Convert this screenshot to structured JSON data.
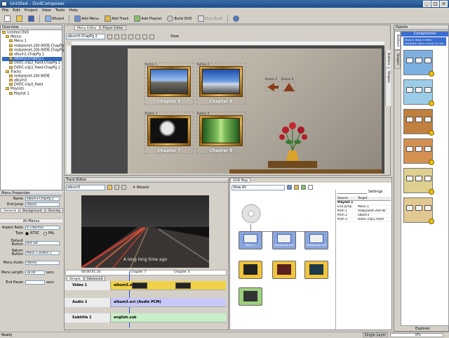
{
  "window": {
    "title": "Untitled - DvdComposer"
  },
  "menubar": [
    "File",
    "Edit",
    "Project",
    "View",
    "Tools",
    "Help"
  ],
  "toolbar": {
    "wizard": "Wizard",
    "add_menu": "Add Menu",
    "add_track": "Add Track",
    "add_playlist": "Add Playlist",
    "build_dvd": "Build DVD",
    "stop_build": "Stop Build"
  },
  "overview": {
    "title": "Overview",
    "tree": [
      {
        "label": "Untitled DVD",
        "indent": 0
      },
      {
        "label": "Menus",
        "indent": 1
      },
      {
        "label": "Menu 1",
        "indent": 2
      },
      {
        "label": "redsplanet-200-90DE-ChapPg 1",
        "indent": 2
      },
      {
        "label": "redsplanet-200-90DE-ChapPg 2",
        "indent": 2
      },
      {
        "label": "album1-ChapPg 1",
        "indent": 2
      },
      {
        "label": "album3-ChapPg 2",
        "indent": 2,
        "selected": true
      },
      {
        "label": "DVDC-clip3_fixed-ChapPg 1",
        "indent": 2
      },
      {
        "label": "DVDC-clip3_fixed-ChapPg 2",
        "indent": 2
      },
      {
        "label": "Tracks",
        "indent": 1
      },
      {
        "label": "redsplanet-200-90DE",
        "indent": 2
      },
      {
        "label": "album3",
        "indent": 2
      },
      {
        "label": "DVDC-clip3_fixed",
        "indent": 2
      },
      {
        "label": "Playlists",
        "indent": 1
      },
      {
        "label": "Playlist 1",
        "indent": 2
      }
    ]
  },
  "properties": {
    "title": "Menu Properties",
    "name_label": "Name",
    "name_value": "album3-ChapPg 2",
    "end_jump_label": "End Jump",
    "end_jump_value": "(None)",
    "tabs": [
      "General",
      "Background",
      "Overlay"
    ],
    "section": "All Menus",
    "aspect_label": "Aspect Ratio",
    "aspect_value": "4:3 Normal",
    "type_label": "Type",
    "type_ntsc": "NTSC",
    "type_pal": "PAL",
    "default_button_label": "Default Button",
    "default_button_value": "Not Set",
    "return_button_label": "Return Button",
    "return_button_value": "Menu 1 Button 1",
    "menu_audio_label": "Menu Audio",
    "menu_audio_value": "(None)",
    "menu_length_label": "Menu Length",
    "menu_length_value": "30.00",
    "menu_length_unit": "secs",
    "end_pause_label": "End Pause",
    "end_pause_unit": "secs"
  },
  "menu_editor": {
    "tabs": [
      "Menu Editor",
      "Player Editor"
    ],
    "current_menu": "album3-ChapPg 2",
    "view_label": "View",
    "chapters": [
      "Chapter 5",
      "Chapter 6",
      "Chapter 7",
      "Chapter 8"
    ],
    "button_labels": [
      "Button 1",
      "Button 2",
      "Button 3",
      "Button 4",
      "Button 5",
      "Button 6"
    ],
    "sidebar_tabs": [
      "Buttons",
      "Shapes"
    ]
  },
  "track_editor": {
    "title": "Track Editor",
    "track": "album3",
    "wizard": "Wizard",
    "caption": "A long long time ago",
    "timecode": "00:00:01:10",
    "chapter_7": "Chapter 7",
    "chapter_8": "Chapter 3",
    "simple_tab": "Simple",
    "advanced_tab": "Advanced",
    "video_label": "Video 1",
    "video_clip": "album3.avi (MP)",
    "audio_label": "Audio 1",
    "audio_clip": "album3.avi (Audio PCM)",
    "subtitle_label": "Subtitle 1",
    "subtitle_clip": "english.sub"
  },
  "dvd_map": {
    "title": "DVD Map",
    "view_label": "View All",
    "settings": "Settings",
    "nodes": [
      "Menu 1",
      "redsplanet-200",
      "redsplanet-200"
    ],
    "table_headers": [
      "Source",
      "Target"
    ],
    "table_rows": [
      [
        "Playlist 1",
        ""
      ],
      [
        "End Jump",
        "Menu 1"
      ],
      [
        "Item 1",
        "redsplanet-200-90"
      ],
      [
        "Item 2",
        "album3"
      ],
      [
        "Item 3",
        "DVDC-clip3_fixed"
      ]
    ]
  },
  "palette": {
    "title": "Palette",
    "components_header": "Components",
    "hint": "Drag & drop a menu template onto a menu to use it",
    "vtabs": [
      "Buttons",
      "Shapes"
    ],
    "explorer": "Explorer"
  },
  "statusbar": {
    "left": "Ready",
    "layer": "Single Layer",
    "free": "0%"
  },
  "colors": {
    "accent": "#316ac5",
    "title_bar": "#1c4c8c",
    "video_track": "#f0d248",
    "audio_track": "#c8c8f8",
    "subtitle_track": "#c8f0c8"
  }
}
